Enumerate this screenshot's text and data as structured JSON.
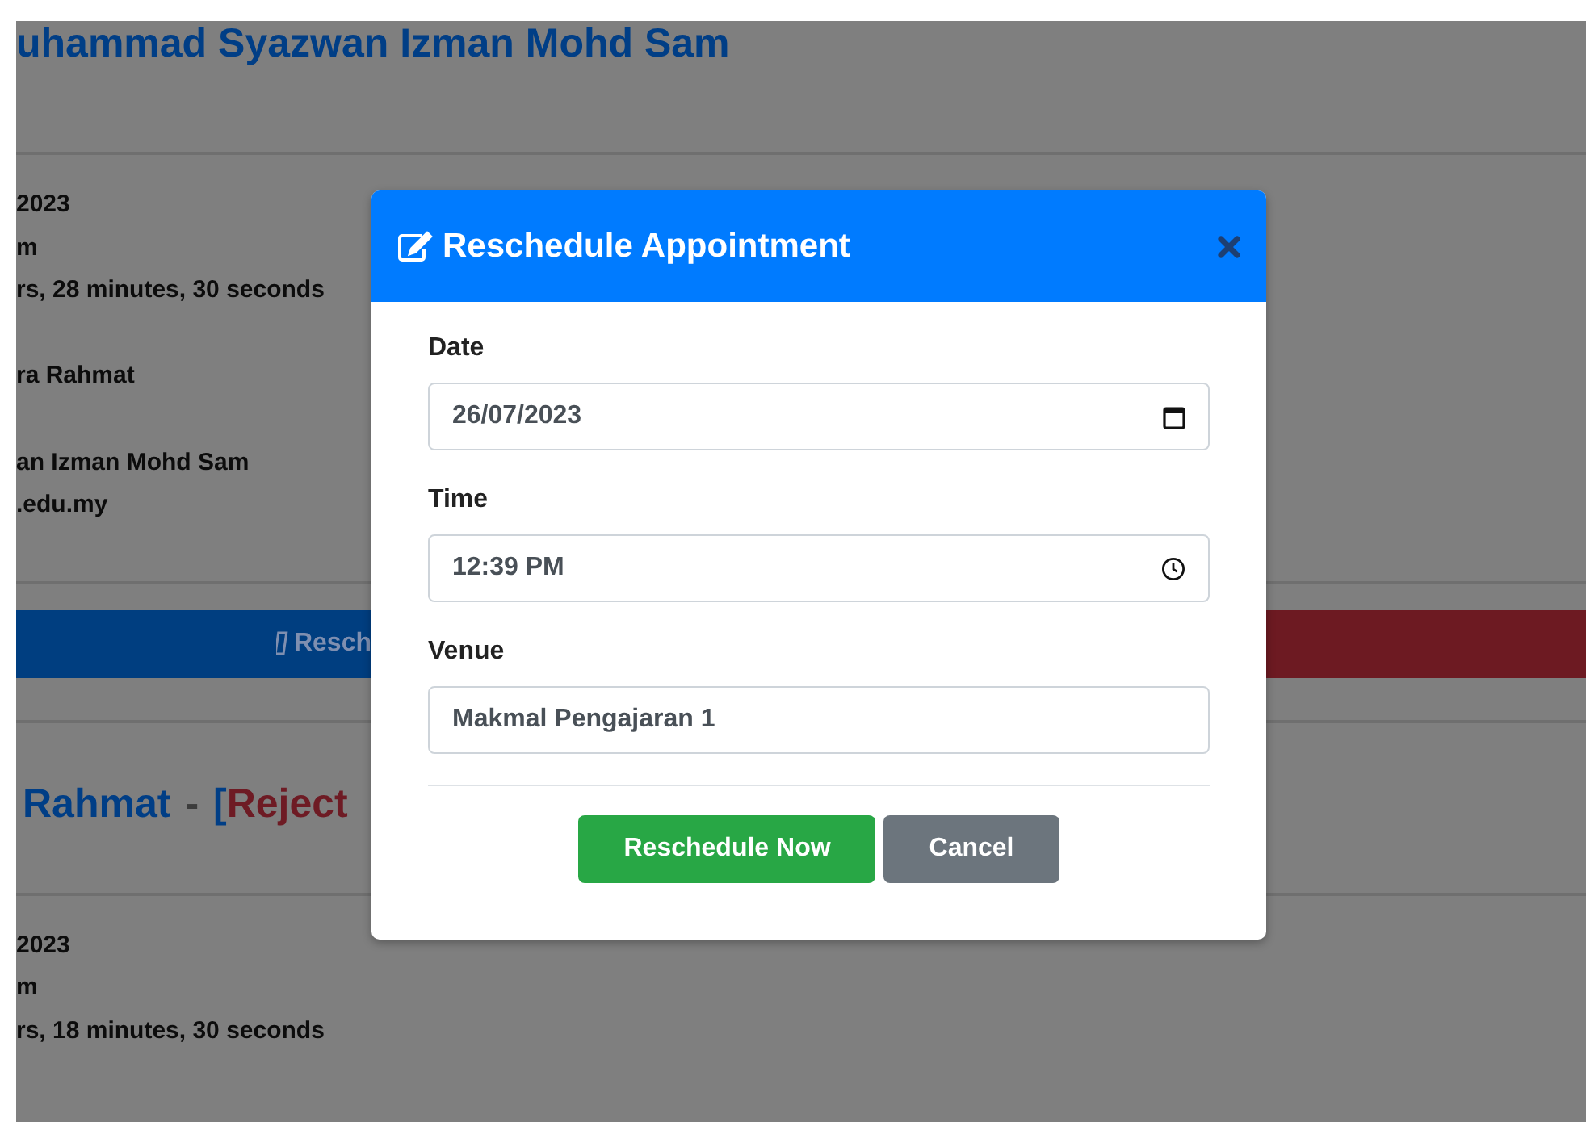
{
  "page": {
    "card_1": {
      "title": "uhammad Syazwan Izman Mohd Sam",
      "detail_groups": [
        [
          "2023",
          "m",
          "rs, 28 minutes, 30 seconds"
        ],
        [
          "ra Rahmat"
        ],
        [
          "an Izman Mohd Sam",
          ".edu.my"
        ]
      ]
    },
    "action_bar": {
      "reschedule_label": "Resch"
    },
    "card_2": {
      "title_parts": [
        {
          "text": "Rahmat",
          "kind": "name"
        },
        {
          "text": "-",
          "kind": "separator"
        },
        {
          "text": "[",
          "kind": "bracket"
        },
        {
          "text": "Reject",
          "kind": "status"
        }
      ],
      "detail_groups": [
        [
          "2023",
          "m",
          "rs, 18 minutes, 30 seconds"
        ]
      ]
    }
  },
  "modal": {
    "title": "Reschedule Appointment",
    "fields": [
      {
        "label": "Date",
        "kind": "date",
        "value": "26/07/2023"
      },
      {
        "label": "Time",
        "kind": "time",
        "value": "12:39 PM"
      },
      {
        "label": "Venue",
        "kind": "text",
        "value": "Makmal Pengajaran 1"
      }
    ],
    "buttons": [
      {
        "label": "Reschedule Now",
        "kind": "primary"
      },
      {
        "label": "Cancel",
        "kind": "secondary"
      }
    ]
  }
}
